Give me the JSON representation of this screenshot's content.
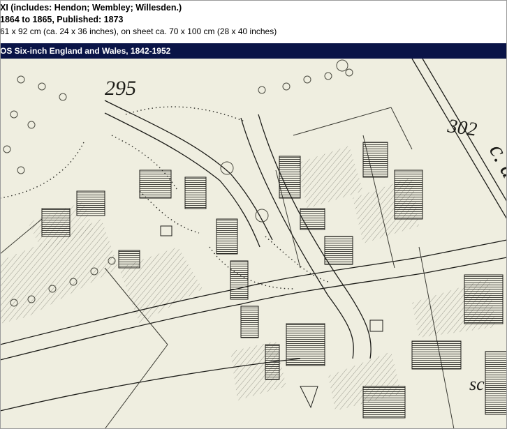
{
  "header": {
    "line1": "XI (includes: Hendon; Wembley; Willesden.)",
    "line2": "1864 to 1865, Published: 1873",
    "line3": "61 x 92 cm (ca. 24 x 36 inches), on sheet ca. 70 x 100 cm (28 x 40 inches)"
  },
  "series_bar": {
    "title": "OS Six-inch England and Wales, 1842-1952"
  },
  "map": {
    "parcel_number_left": "295",
    "parcel_number_right": "302",
    "road_lettering_right": "c. a",
    "lettering_bottom_right": "sc",
    "paper_color": "#efeee0",
    "ink_color": "#1c1c18"
  }
}
